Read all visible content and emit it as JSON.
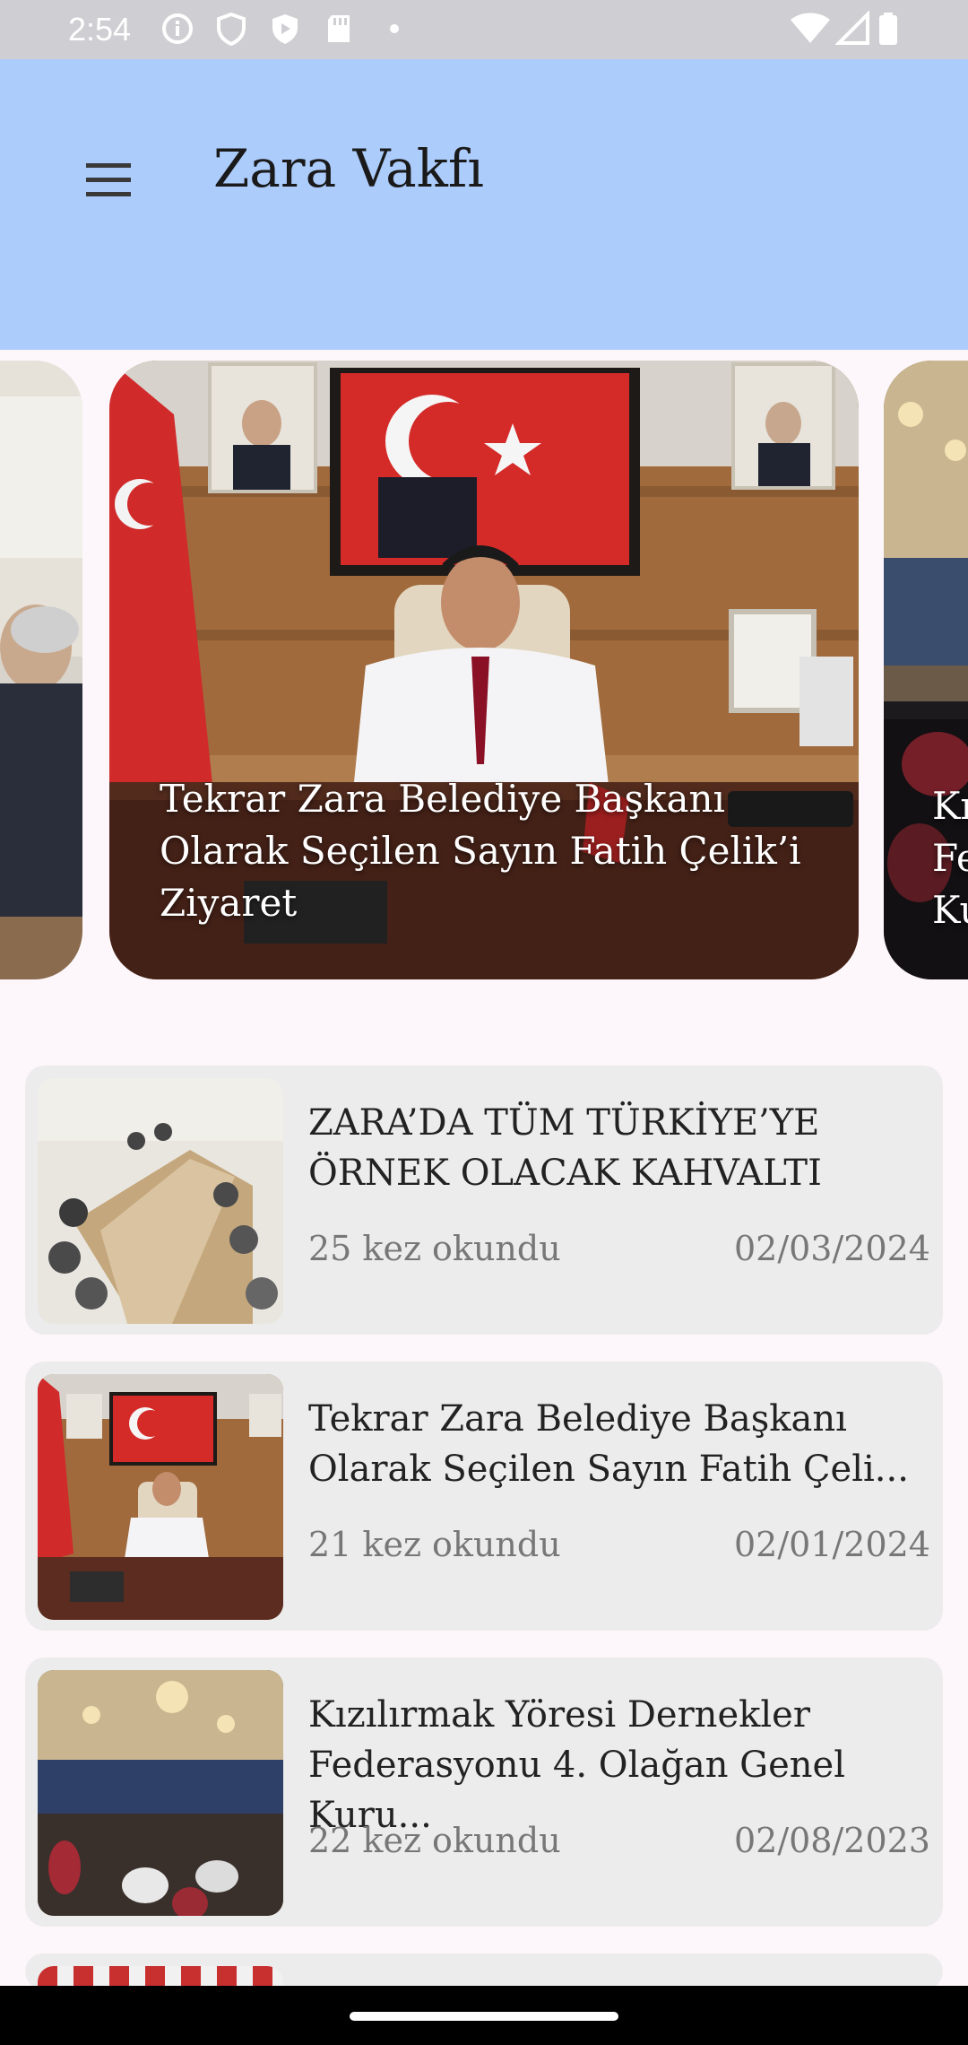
{
  "status_bar": {
    "time": "2:54",
    "icons": [
      "info-icon",
      "shield-icon",
      "play-protect-icon",
      "sd-card-icon",
      "dot-icon",
      "wifi-icon",
      "signal-icon",
      "battery-icon"
    ]
  },
  "app_bar": {
    "title": "Zara Vakfı",
    "menu_icon": "hamburger-menu-icon"
  },
  "carousel": {
    "slides": [
      {
        "caption": ""
      },
      {
        "caption": "Tekrar Zara Belediye Başkanı Olarak Seçilen Sayın Fatih Çelik’i Ziyaret"
      },
      {
        "caption_partial_lines": [
          "Kı",
          "Fe",
          "Ku"
        ]
      }
    ]
  },
  "news": [
    {
      "title": "ZARA’DA TÜM TÜRKİYE’YE ÖRNEK OLACAK KAHVALTI",
      "views": "25 kez okundu",
      "date": "02/03/2024"
    },
    {
      "title": "Tekrar Zara Belediye Başkanı Olarak Seçilen Sayın Fatih Çeli...",
      "views": "21 kez okundu",
      "date": "02/01/2024"
    },
    {
      "title": "Kızılırmak Yöresi Dernekler Federasyonu 4. Olağan Genel Kuru...",
      "views": "22 kez okundu",
      "date": "02/08/2023"
    }
  ],
  "colors": {
    "app_bar": "#acccfc",
    "background": "#fdf7fb",
    "card": "#ececec",
    "status_bar": "#cfcfd3"
  }
}
